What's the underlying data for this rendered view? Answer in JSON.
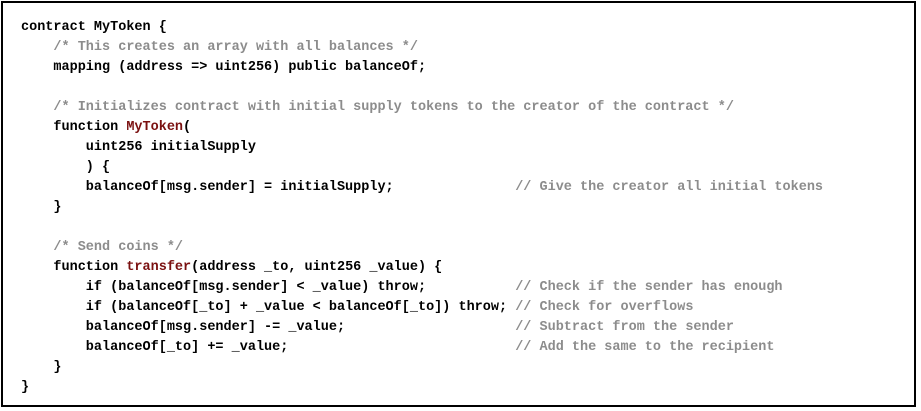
{
  "code": {
    "lines": [
      [
        {
          "t": "contract MyToken {",
          "k": "code"
        }
      ],
      [
        {
          "t": "    ",
          "k": "code"
        },
        {
          "t": "/* This creates an array with all balances */",
          "k": "comment"
        }
      ],
      [
        {
          "t": "    mapping (address => uint256) public balanceOf;",
          "k": "code"
        }
      ],
      [
        {
          "t": "",
          "k": "code"
        }
      ],
      [
        {
          "t": "    ",
          "k": "code"
        },
        {
          "t": "/* Initializes contract with initial supply tokens to the creator of the contract */",
          "k": "comment"
        }
      ],
      [
        {
          "t": "    function ",
          "k": "code"
        },
        {
          "t": "MyToken",
          "k": "fn"
        },
        {
          "t": "(",
          "k": "code"
        }
      ],
      [
        {
          "t": "        uint256 initialSupply",
          "k": "code"
        }
      ],
      [
        {
          "t": "        ) {",
          "k": "code"
        }
      ],
      [
        {
          "t": "        balanceOf[msg.sender] = initialSupply;               ",
          "k": "code"
        },
        {
          "t": "// Give the creator all initial tokens",
          "k": "comment"
        }
      ],
      [
        {
          "t": "    }",
          "k": "code"
        }
      ],
      [
        {
          "t": "",
          "k": "code"
        }
      ],
      [
        {
          "t": "    ",
          "k": "code"
        },
        {
          "t": "/* Send coins */",
          "k": "comment"
        }
      ],
      [
        {
          "t": "    function ",
          "k": "code"
        },
        {
          "t": "transfer",
          "k": "fn"
        },
        {
          "t": "(address _to, uint256 _value) {",
          "k": "code"
        }
      ],
      [
        {
          "t": "        if (balanceOf[msg.sender] < _value) throw;           ",
          "k": "code"
        },
        {
          "t": "// Check if the sender has enough",
          "k": "comment"
        }
      ],
      [
        {
          "t": "        if (balanceOf[_to] + _value < balanceOf[_to]) throw; ",
          "k": "code"
        },
        {
          "t": "// Check for overflows",
          "k": "comment"
        }
      ],
      [
        {
          "t": "        balanceOf[msg.sender] -= _value;                     ",
          "k": "code"
        },
        {
          "t": "// Subtract from the sender",
          "k": "comment"
        }
      ],
      [
        {
          "t": "        balanceOf[_to] += _value;                            ",
          "k": "code"
        },
        {
          "t": "// Add the same to the recipient",
          "k": "comment"
        }
      ],
      [
        {
          "t": "    }",
          "k": "code"
        }
      ],
      [
        {
          "t": "}",
          "k": "code"
        }
      ]
    ]
  },
  "colors": {
    "code": "#000000",
    "comment": "#8c8c8c",
    "function_name": "#7a1010",
    "border": "#000000",
    "background": "#ffffff"
  }
}
